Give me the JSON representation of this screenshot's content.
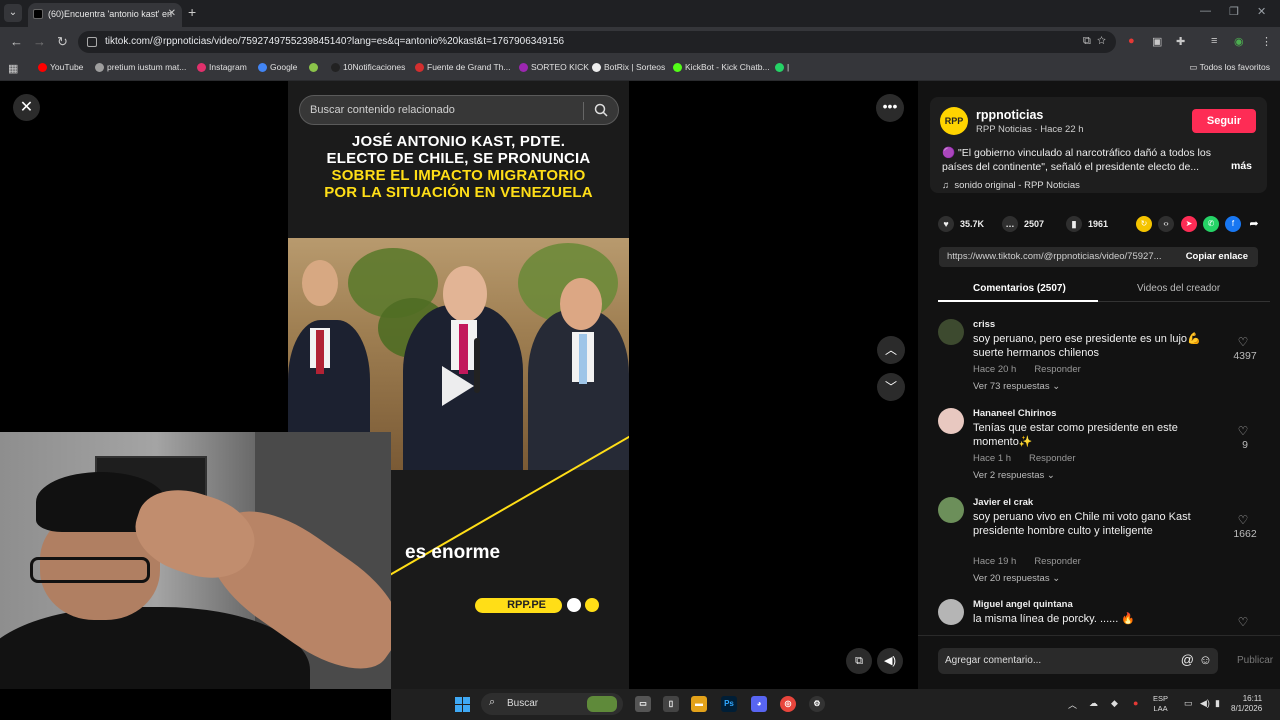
{
  "browser": {
    "tab_title": "(60)Encuentra 'antonio kast' en",
    "url": "tiktok.com/@rppnoticias/video/7592749755239845140?lang=es&q=antonio%20kast&t=1767906349156",
    "bookmarks": [
      {
        "label": "YouTube",
        "color": "#ff0000"
      },
      {
        "label": "pretium iustum mat...",
        "color": "#9e9e9e"
      },
      {
        "label": "Instagram",
        "color": "#e1306c"
      },
      {
        "label": "Google",
        "color": "#4285f4"
      },
      {
        "label": "",
        "color": "#8bc34a"
      },
      {
        "label": "10Notificaciones",
        "color": "#222222"
      },
      {
        "label": "Fuente de Grand Th...",
        "color": "#d32f2f"
      },
      {
        "label": "SORTEO KICK",
        "color": "#9c27b0"
      },
      {
        "label": "BotRix | Sorteos",
        "color": "#eeeeee"
      },
      {
        "label": "KickBot - Kick Chatb...",
        "color": "#53fc18"
      },
      {
        "label": "|",
        "color": "#25d366"
      }
    ],
    "all_favorites": "Todos los favoritos"
  },
  "video": {
    "search_placeholder": "Buscar contenido relacionado",
    "headline_white_1": "JOSÉ ANTONIO KAST, PDTE.",
    "headline_white_2": "ELECTO DE CHILE, SE PRONUNCIA",
    "headline_yellow_1": "SOBRE EL IMPACTO MIGRATORIO",
    "headline_yellow_2": "POR LA SITUACIÓN EN VENEZUELA",
    "caption": "es enorme",
    "brand": "RPP.PE"
  },
  "author": {
    "avatar_text": "RPP",
    "name": "rppnoticias",
    "meta": "RPP Noticias · Hace 22 h",
    "follow_label": "Seguir",
    "description": "\"El gobierno vinculado al narcotráfico dañó a todos los países del continente\", señaló el presidente electo de...",
    "more": "más",
    "sound": "sonido original - RPP Noticias"
  },
  "stats": {
    "likes": "35.7K",
    "comments": "2507",
    "saves": "1961"
  },
  "share": {
    "link": "https://www.tiktok.com/@rppnoticias/video/75927...",
    "copy_label": "Copiar enlace"
  },
  "tabs": {
    "comments": "Comentarios (2507)",
    "creator_videos": "Videos del creador"
  },
  "comments": [
    {
      "user": "criss",
      "text": "soy peruano, pero ese presidente es un lujo💪 suerte hermanos chilenos",
      "time": "Hace 20 h",
      "reply": "Responder",
      "replies": "Ver 73 respuestas ⌄",
      "likes": "4397",
      "avatar": "#3d4a2f"
    },
    {
      "user": "Hananeel Chirinos",
      "text": "Tenías que estar como presidente en este momento✨",
      "time": "Hace 1 h",
      "reply": "Responder",
      "replies": "Ver 2 respuestas ⌄",
      "likes": "9",
      "avatar": "#e8c8c0"
    },
    {
      "user": "Javier el crak",
      "text": "soy peruano vivo en Chile mi voto gano Kast presidente hombre culto y inteligente",
      "time": "Hace 19 h",
      "reply": "Responder",
      "replies": "Ver 20 respuestas ⌄",
      "likes": "1662",
      "avatar": "#6c8f5a"
    },
    {
      "user": "Miguel angel quintana",
      "text": "la misma línea de porcky. ...... 🔥",
      "likes": "",
      "avatar": "#b5b5b5"
    }
  ],
  "comment_bar": {
    "placeholder": "Agregar comentario...",
    "publish": "Publicar"
  },
  "taskbar": {
    "search": "Buscar",
    "lang_1": "ESP",
    "lang_2": "LAA",
    "time": "16:11",
    "date": "8/1/2026"
  }
}
